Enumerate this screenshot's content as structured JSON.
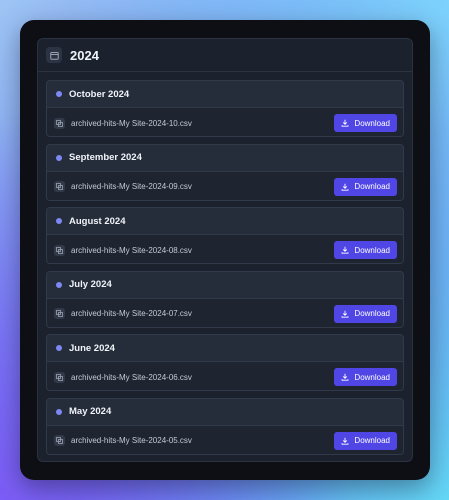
{
  "year": "2024",
  "colors": {
    "accent": "#4f46e5",
    "dot": "#7e88f4",
    "panel": "#1b212d",
    "card": "#252c3a"
  },
  "months": [
    {
      "title": "October 2024",
      "file": "archived-hits-My Site-2024-10.csv",
      "button": "Download"
    },
    {
      "title": "September 2024",
      "file": "archived-hits-My Site-2024-09.csv",
      "button": "Download"
    },
    {
      "title": "August 2024",
      "file": "archived-hits-My Site-2024-08.csv",
      "button": "Download"
    },
    {
      "title": "July 2024",
      "file": "archived-hits-My Site-2024-07.csv",
      "button": "Download"
    },
    {
      "title": "June 2024",
      "file": "archived-hits-My Site-2024-06.csv",
      "button": "Download"
    },
    {
      "title": "May 2024",
      "file": "archived-hits-My Site-2024-05.csv",
      "button": "Download"
    }
  ]
}
